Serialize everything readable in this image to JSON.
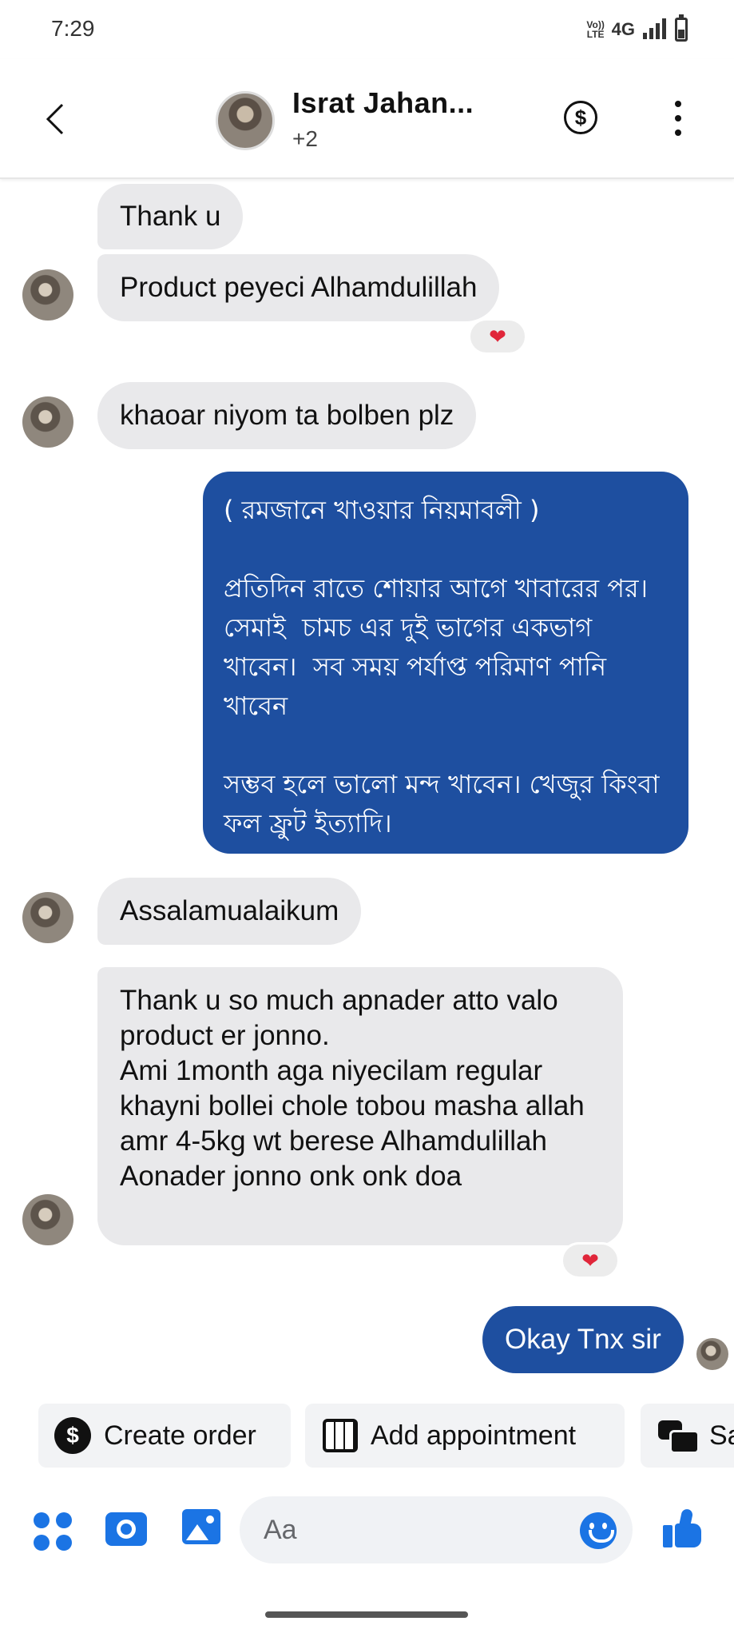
{
  "status_bar": {
    "time": "7:29",
    "volte": "Vo)) LTE",
    "network": "4G"
  },
  "header": {
    "back_icon": "chevron-left-icon",
    "name": "Israt Jahan...",
    "participants": "+2",
    "dollar_symbol": "$"
  },
  "messages": [
    {
      "direction": "incoming",
      "text": "Thank u"
    },
    {
      "direction": "incoming",
      "text": "Product peyeci Alhamdulillah",
      "reaction": "❤"
    },
    {
      "direction": "incoming",
      "text": "khaoar niyom ta bolben plz"
    },
    {
      "direction": "outgoing",
      "text": "( রমজানে খাওয়ার নিয়মাবলী )\n\nপ্রতিদিন রাতে শোয়ার আগে খাবারের পর।  সেমাই  চামচ এর দুই ভাগের একভাগ খাবেন।  সব সময় পর্যাপ্ত পরিমাণ পানি খাবেন\n\nসম্ভব হলে ভালো মন্দ খাবেন। খেজুর কিংবা ফল ফ্রুট ইত্যাদি।"
    },
    {
      "direction": "incoming",
      "text": "Assalamualaikum"
    },
    {
      "direction": "incoming",
      "text": "Thank u so much apnader atto valo product er jonno.\nAmi 1month aga niyecilam regular khayni bollei chole tobou masha allah amr 4-5kg wt berese Alhamdulillah\nAonader jonno onk onk doa",
      "reaction": "❤"
    },
    {
      "direction": "outgoing",
      "text": "Okay Tnx sir"
    }
  ],
  "quick_actions": [
    {
      "label": "Create order",
      "icon": "dollar-circle-icon"
    },
    {
      "label": "Add appointment",
      "icon": "calendar-icon"
    },
    {
      "label": "Sa",
      "icon": "chat-bubbles-icon"
    }
  ],
  "composer": {
    "placeholder": "Aa"
  },
  "colors": {
    "outgoing_bubble": "#1e4fa0",
    "incoming_bubble": "#e9e9eb",
    "accent": "#1b74e4",
    "reaction_heart": "#e0263a"
  }
}
